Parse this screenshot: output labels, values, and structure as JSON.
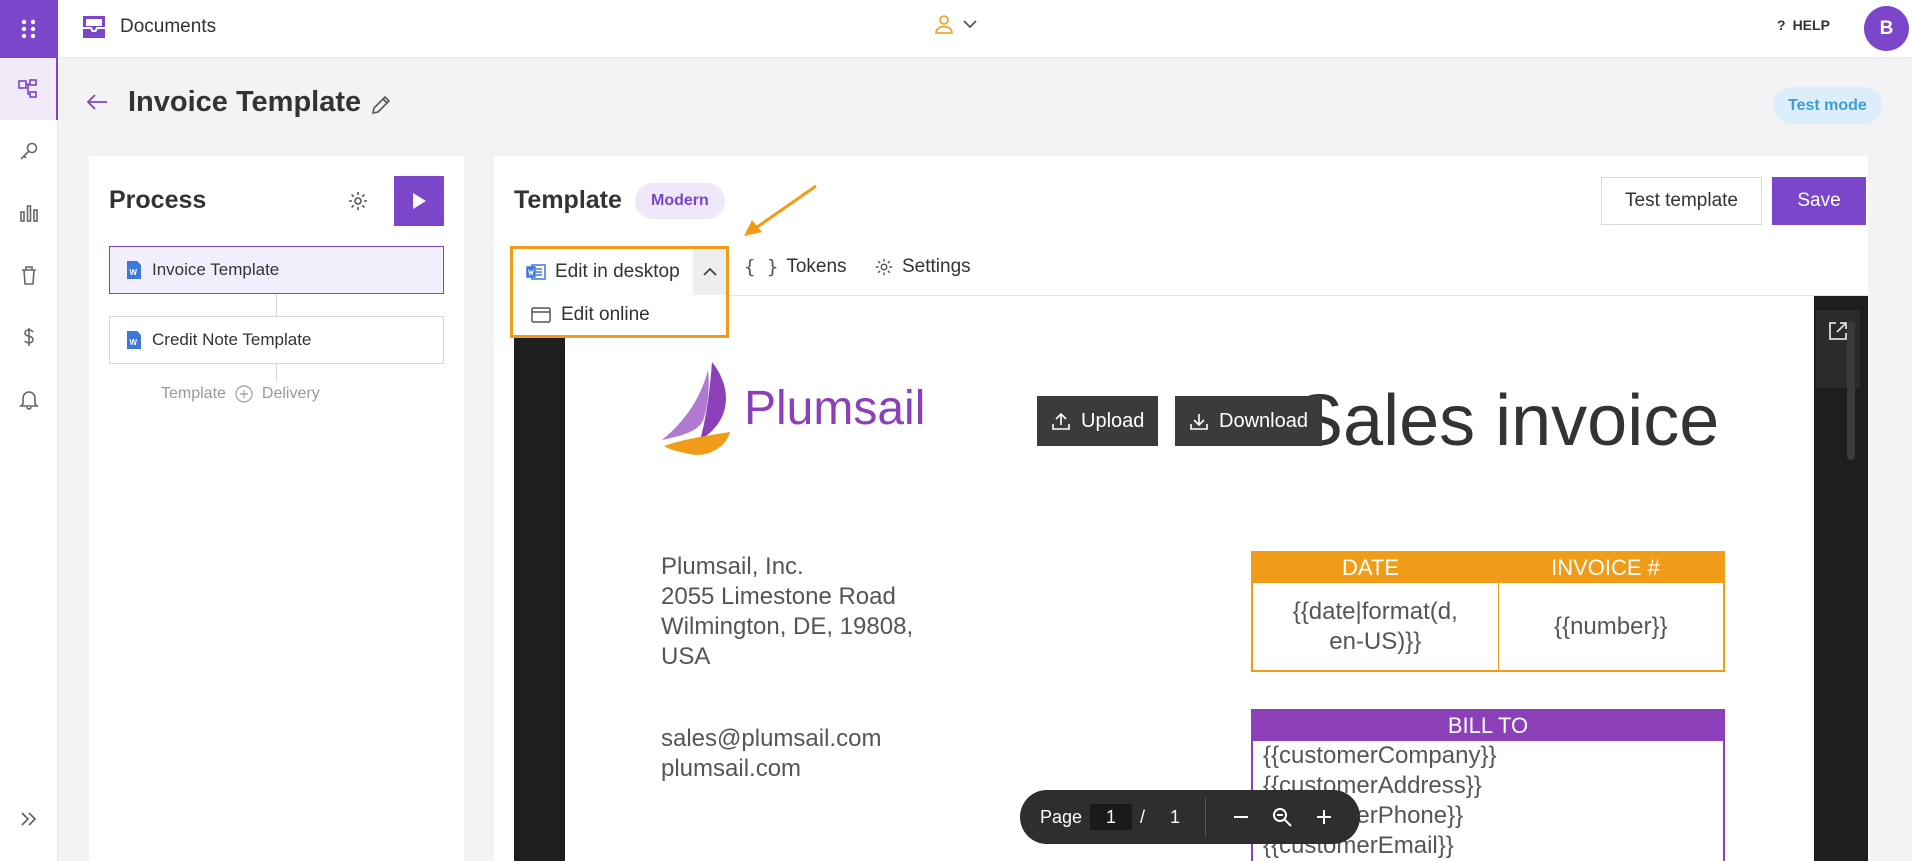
{
  "app": {
    "name": "Documents",
    "help_label": "HELP",
    "avatar_initial": "B"
  },
  "page": {
    "title": "Invoice Template",
    "test_mode_label": "Test mode"
  },
  "process": {
    "title": "Process",
    "items": [
      {
        "label": "Invoice Template",
        "selected": true
      },
      {
        "label": "Credit Note Template",
        "selected": false
      }
    ],
    "footer_left": "Template",
    "footer_right": "Delivery"
  },
  "template": {
    "title": "Template",
    "badge": "Modern",
    "test_button": "Test template",
    "save_button": "Save",
    "edit_desktop": "Edit in desktop",
    "edit_online": "Edit online",
    "tab_tokens": "Tokens",
    "tab_settings": "Settings"
  },
  "document": {
    "logo_text": "Plumsail",
    "upload_label": "Upload",
    "download_label": "Download",
    "title": "Sales invoice",
    "address": [
      "Plumsail, Inc.",
      "2055 Limestone Road",
      "Wilmington, DE, 19808,",
      "USA"
    ],
    "contact": [
      "sales@plumsail.com",
      "plumsail.com"
    ],
    "date_header": "DATE",
    "invoice_header": "INVOICE #",
    "date_value_1": "{{date|format(d,",
    "date_value_2": "en-US)}}",
    "invoice_value": "{{number}}",
    "bill_to_header": "BILL TO",
    "bill_to_lines": [
      "{{customerCompany}}",
      "{{customerAddress}}",
      "{{customerPhone}}",
      "{{customerEmail}}"
    ]
  },
  "pager": {
    "label": "Page",
    "current": "1",
    "separator": "/",
    "total": "1"
  },
  "colors": {
    "accent": "#7b46c9",
    "highlight": "#f19c18",
    "plum": "#8b3fb8",
    "info": "#3a9ed8"
  }
}
